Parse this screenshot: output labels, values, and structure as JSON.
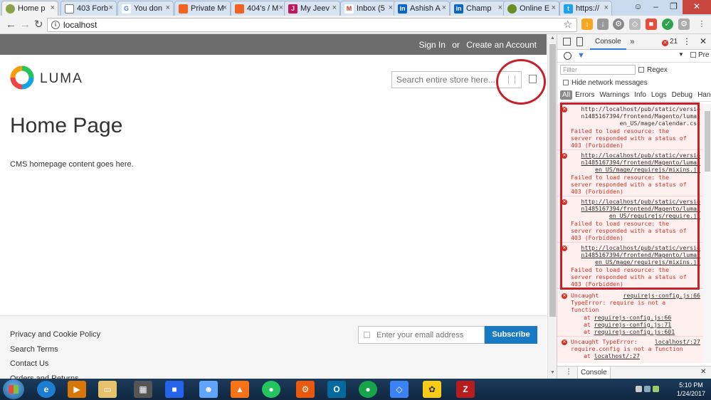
{
  "browser": {
    "tabs": [
      {
        "label": "Home p",
        "icon": "magento-icon",
        "active": true
      },
      {
        "label": "403 Forb",
        "icon": "page-icon",
        "active": false
      },
      {
        "label": "You don",
        "icon": "google-icon",
        "active": false
      },
      {
        "label": "Private M",
        "icon": "magento-icon",
        "active": false
      },
      {
        "label": "404's / M",
        "icon": "magento-icon",
        "active": false
      },
      {
        "label": "My Jeev",
        "icon": "jeevan-icon",
        "active": false
      },
      {
        "label": "Inbox (5",
        "icon": "gmail-icon",
        "active": false
      },
      {
        "label": "Ashish A",
        "icon": "linkedin-icon",
        "active": false
      },
      {
        "label": "Champ",
        "icon": "linkedin-icon",
        "active": false
      },
      {
        "label": "Online E",
        "icon": "online-icon",
        "active": false
      },
      {
        "label": "https://",
        "icon": "twitter-icon",
        "active": false
      }
    ],
    "address": "localhost"
  },
  "page": {
    "header_links": {
      "sign_in": "Sign In",
      "or": "or",
      "create": "Create an Account"
    },
    "logo": "LUMA",
    "search_placeholder": "Search entire store here...",
    "title": "Home Page",
    "content": "CMS homepage content goes here.",
    "footer_links": [
      "Privacy and Cookie Policy",
      "Search Terms",
      "Contact Us",
      "Orders and Returns"
    ],
    "newsletter_placeholder": "Enter your email address",
    "subscribe": "Subscribe"
  },
  "devtools": {
    "tab": "Console",
    "error_count": "21",
    "preserve": "Pre",
    "filter_placeholder": "Filter",
    "regex": "Regex",
    "hide_network": "Hide network messages",
    "levels": [
      "All",
      "Errors",
      "Warnings",
      "Info",
      "Logs",
      "Debug",
      "Handled"
    ],
    "entries": [
      {
        "url1": "http://localhost/pub/static/versio",
        "url2": "n1485167394/frontend/Magento/luma/",
        "url3": "en_US/mage/calendar.css",
        "underlined": false,
        "msg1": "Failed to load resource: the",
        "msg2": "server responded with a status of",
        "msg3": "403 (Forbidden)"
      },
      {
        "url1": "http://localhost/pub/static/versio",
        "url2": "n1485167394/frontend/Magento/luma/",
        "url3": "en_US/mage/requirejs/mixins.js",
        "underlined": true,
        "msg1": "Failed to load resource: the",
        "msg2": "server responded with a status of",
        "msg3": "403 (Forbidden)"
      },
      {
        "url1": "http://localhost/pub/static/versio",
        "url2": "n1485167394/frontend/Magento/luma/",
        "url3": "en_US/requirejs/require.js",
        "underlined": true,
        "msg1": "Failed to load resource: the",
        "msg2": "server responded with a status of",
        "msg3": "403 (Forbidden)"
      },
      {
        "url1": "http://localhost/pub/static/versio",
        "url2": "n1485167394/frontend/Magento/luma/",
        "url3": "en_US/mage/requirejs/mixins.js",
        "underlined": true,
        "msg1": "Failed to load resource: the",
        "msg2": "server responded with a status of",
        "msg3": "403 (Forbidden)"
      }
    ],
    "uncaught1": {
      "label": "Uncaught",
      "source": "requirejs-config.js:66",
      "line1": "TypeError: require is not a",
      "line2": "function",
      "at1": "requirejs-config.js:66",
      "at2": "requirejs-config.js:71",
      "at3": "requirejs-config.js:601",
      "at": "at"
    },
    "uncaught2": {
      "label": "Uncaught TypeError:",
      "source": "localhost/:27",
      "line1": "require.config is not a function",
      "at1": "localhost/:27",
      "at": "at"
    },
    "drawer_tab": "Console"
  },
  "taskbar": {
    "time": "5:10 PM",
    "date": "1/24/2017"
  },
  "colors": {
    "header_gray": "#6d6d6d",
    "subscribe_blue": "#1979c3",
    "error_red": "#d93025",
    "highlight_red": "#c8202a"
  }
}
